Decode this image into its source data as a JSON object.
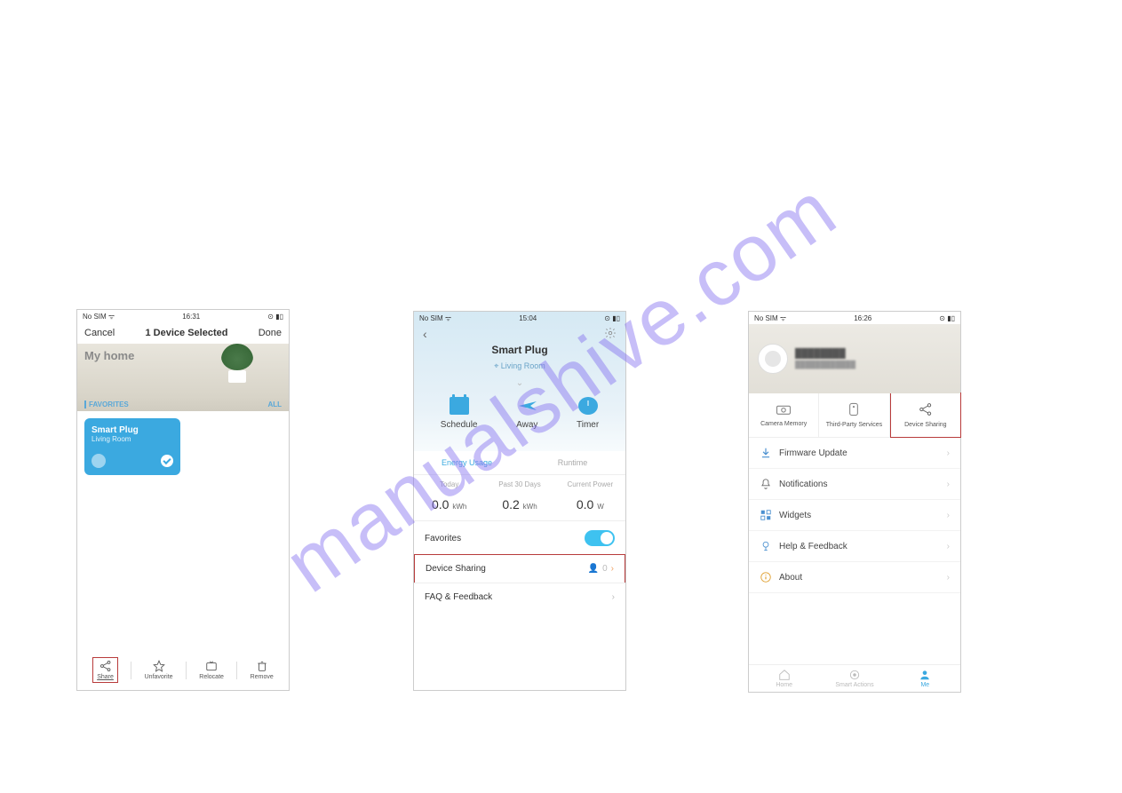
{
  "watermark": "manualshive.com",
  "phone1": {
    "status": {
      "left": "No SIM ᯤ",
      "time": "16:31",
      "right": "⊙ ▮▯"
    },
    "topbar": {
      "cancel": "Cancel",
      "title": "1 Device Selected",
      "done": "Done"
    },
    "hero_title": "My home",
    "favrow": {
      "fav": "FAVORITES",
      "all": "ALL"
    },
    "card": {
      "name": "Smart Plug",
      "room": "Living Room"
    },
    "bottombar": {
      "share": "Share",
      "unfavorite": "Unfavorite",
      "relocate": "Relocate",
      "remove": "Remove"
    }
  },
  "phone2": {
    "status": {
      "left": "No SIM ᯤ",
      "time": "15:04",
      "right": "⊙ ▮▯"
    },
    "title": "Smart Plug",
    "subtitle": "Living Room",
    "actions": {
      "schedule": "Schedule",
      "away": "Away",
      "timer": "Timer"
    },
    "tabs": {
      "energy": "Energy Usage",
      "runtime": "Runtime"
    },
    "stats": {
      "today_label": "Today",
      "today_value": "0.0",
      "today_unit": "kWh",
      "past_label": "Past 30 Days",
      "past_value": "0.2",
      "past_unit": "kWh",
      "power_label": "Current Power",
      "power_value": "0.0",
      "power_unit": "W"
    },
    "rows": {
      "favorites": "Favorites",
      "device_sharing": "Device Sharing",
      "device_sharing_count": "0",
      "faq": "FAQ & Feedback"
    }
  },
  "phone3": {
    "status": {
      "left": "No SIM ᯤ",
      "time": "16:26",
      "right": "⊙ ▮▯"
    },
    "tiles": {
      "camera": "Camera Memory",
      "thirdparty": "Third-Party Services",
      "sharing": "Device Sharing"
    },
    "list": {
      "firmware": "Firmware Update",
      "notifications": "Notifications",
      "widgets": "Widgets",
      "help": "Help & Feedback",
      "about": "About"
    },
    "tabbar": {
      "home": "Home",
      "smart": "Smart Actions",
      "me": "Me"
    }
  }
}
